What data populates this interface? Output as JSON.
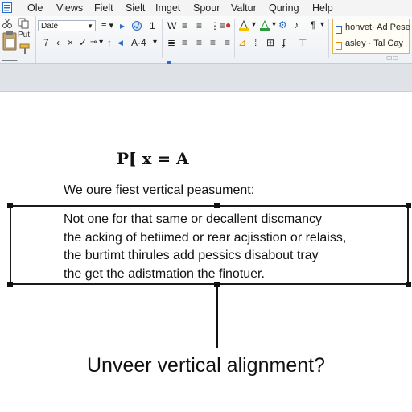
{
  "menu": [
    "Ole",
    "Views",
    "Fielt",
    "Sielt",
    "Imget",
    "Spour",
    "Valtur",
    "Quring",
    "Help"
  ],
  "ribbon": {
    "paste_label": "Put",
    "font_name": "Date",
    "font_size": "1",
    "font_size_grow": "A·4",
    "number_1": "7",
    "styles": [
      "honvet· Ad Pese",
      "asley · Tal Cay"
    ],
    "colors": {
      "highlight": "#f2c200",
      "font_color": "#c0392b",
      "accent_blue": "#2b6cc4",
      "green": "#2e9a3e"
    }
  },
  "document": {
    "formula": "P[ x = A",
    "intro": "We oure fiest vertical peasument:",
    "paragraph": [
      "Not one for that same or decallent discmancy",
      "the acking of betiimed or rear acjisstion or relaiss,",
      "the burtimt thirules add pessics disabout tray",
      "the get the adistmation the finotuer."
    ],
    "question": "Unveer vertical alignment?"
  }
}
